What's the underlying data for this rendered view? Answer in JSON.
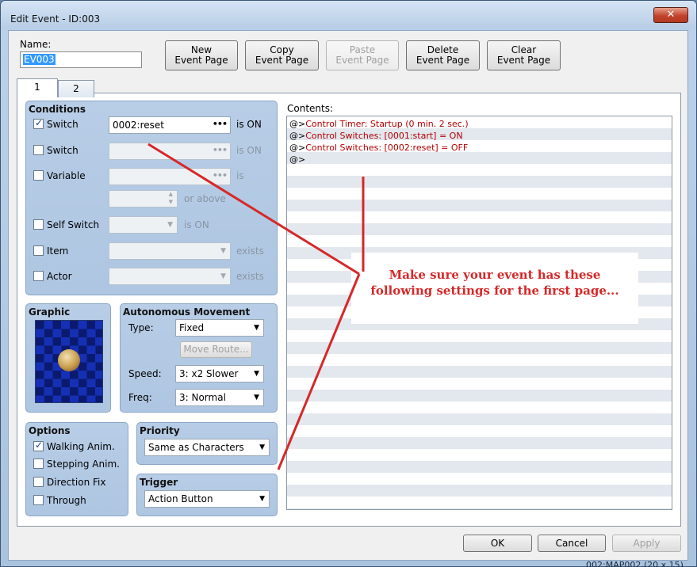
{
  "window": {
    "title": "Edit Event - ID:003",
    "close_glyph": "✕"
  },
  "name_label": "Name:",
  "name_value": "EV003",
  "toolbar": {
    "new_line1": "New",
    "new_line2": "Event Page",
    "copy_line1": "Copy",
    "copy_line2": "Event Page",
    "paste_line1": "Paste",
    "paste_line2": "Event Page",
    "delete_line1": "Delete",
    "delete_line2": "Event Page",
    "clear_line1": "Clear",
    "clear_line2": "Event Page"
  },
  "tabs": [
    {
      "label": "1"
    },
    {
      "label": "2"
    }
  ],
  "conditions": {
    "title": "Conditions",
    "switch1": {
      "label": "Switch",
      "value": "0002:reset",
      "suffix": "is ON",
      "checked": true
    },
    "switch2": {
      "label": "Switch",
      "value": "",
      "suffix": "is ON",
      "checked": false
    },
    "variable": {
      "label": "Variable",
      "value": "",
      "suffix": "is",
      "or_above": "or above",
      "checked": false
    },
    "self_switch": {
      "label": "Self Switch",
      "suffix": "is ON",
      "checked": false
    },
    "item": {
      "label": "Item",
      "suffix": "exists",
      "checked": false
    },
    "actor": {
      "label": "Actor",
      "suffix": "exists",
      "checked": false
    }
  },
  "graphic": {
    "title": "Graphic"
  },
  "autonomous": {
    "title": "Autonomous Movement",
    "type_label": "Type:",
    "type_value": "Fixed",
    "move_route": "Move Route...",
    "speed_label": "Speed:",
    "speed_value": "3: x2 Slower",
    "freq_label": "Freq:",
    "freq_value": "3: Normal"
  },
  "options": {
    "title": "Options",
    "walking": {
      "label": "Walking Anim.",
      "checked": true
    },
    "stepping": {
      "label": "Stepping Anim.",
      "checked": false
    },
    "direction_fix": {
      "label": "Direction Fix",
      "checked": false
    },
    "through": {
      "label": "Through",
      "checked": false
    }
  },
  "priority": {
    "title": "Priority",
    "value": "Same as Characters"
  },
  "trigger": {
    "title": "Trigger",
    "value": "Action Button"
  },
  "contents": {
    "title": "Contents:",
    "lines": [
      {
        "prefix": "@>",
        "text": "Control Timer: Startup (0 min. 2 sec.)"
      },
      {
        "prefix": "@>",
        "text": "Control Switches: [0001:start] = ON"
      },
      {
        "prefix": "@>",
        "text": "Control Switches: [0002:reset] = OFF"
      },
      {
        "prefix": "@>",
        "text": ""
      }
    ]
  },
  "annotation": {
    "line1": "Make sure your event has these",
    "line2": "following settings for the first page...",
    "color": "#d62828"
  },
  "buttons": {
    "ok": "OK",
    "cancel": "Cancel",
    "apply": "Apply"
  },
  "status_text": "002:MAP002 (20 x 15)",
  "icons": {
    "dropdown": "▼",
    "ellipsis": "•••",
    "spin_up": "▲",
    "spin_down": "▼"
  }
}
